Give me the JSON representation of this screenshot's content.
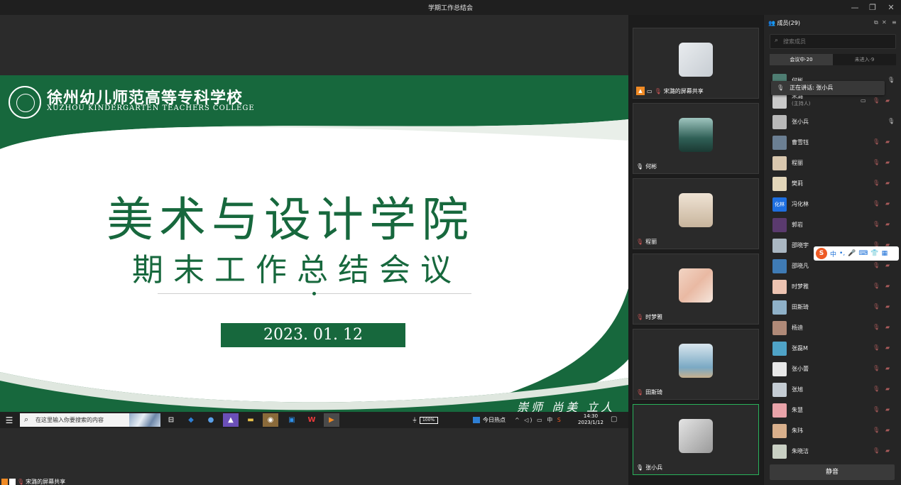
{
  "window": {
    "title": "学期工作总结会",
    "minimize": "—",
    "restore": "❐",
    "close": "✕"
  },
  "slide": {
    "school_cn": "徐州幼儿师范高等专科学校",
    "school_en": "XUZHOU KINDERGARTEN TEACHERS COLLEGE",
    "title": "美术与设计学院",
    "subtitle": "期末工作总结会议",
    "date": "2023. 01. 12",
    "motto": "崇师 尚美 立人",
    "accent_color": "#17683d"
  },
  "taskbar": {
    "search_placeholder": "在这里输入你要搜索的内容",
    "battery": "100%",
    "news": "今日热点",
    "ime_indicator": "中",
    "time": "14:30",
    "date": "2023/1/12"
  },
  "share_label": "宋潞的屏幕共享",
  "video_tiles": [
    {
      "name": "宋潞的屏幕共享",
      "icon": "screen-share-icon",
      "av": "linear-gradient(135deg,#e9ecef,#c7cdd3)"
    },
    {
      "name": "何彬",
      "icon": "mic-icon",
      "av": "linear-gradient(180deg,#9fc5bf,#2f5f56 60%,#1b3a33)"
    },
    {
      "name": "程丽",
      "icon": "mic-muted-icon",
      "av": "linear-gradient(180deg,#efe3d4,#c8b59d)"
    },
    {
      "name": "时梦雅",
      "icon": "mic-muted-icon",
      "av": "linear-gradient(135deg,#f2d5c4,#e9b9a3 50%,#f5e6dc)"
    },
    {
      "name": "田斯琦",
      "icon": "mic-muted-icon",
      "av": "linear-gradient(180deg,#d9e6ee,#7aa9c4 70%,#c7b08e)"
    },
    {
      "name": "张小兵",
      "icon": "mic-icon",
      "av": "linear-gradient(135deg,#e4e4e4,#9a9a9a)"
    }
  ],
  "panel": {
    "title": "成员(29)",
    "search_placeholder": "搜索成员",
    "tab_in": "会议中·20",
    "tab_out": "未进入·9",
    "speaking": "正在讲话: 张小兵",
    "mute_all": "静音",
    "members": [
      {
        "name": "何彬",
        "role": "",
        "av": "#4e7d72",
        "mic": "on",
        "cam": false,
        "scr": false
      },
      {
        "name": "宋潞",
        "role": "(主持人)",
        "av": "#c9c9c9",
        "mic": "off",
        "cam": true,
        "scr": true
      },
      {
        "name": "张小兵",
        "role": "",
        "av": "#b9b9b9",
        "mic": "on",
        "cam": false,
        "scr": false
      },
      {
        "name": "曹雪钰",
        "role": "",
        "av": "#6b7f93",
        "mic": "off",
        "cam": true,
        "scr": false
      },
      {
        "name": "程丽",
        "role": "",
        "av": "#d9c7ae",
        "mic": "off",
        "cam": true,
        "scr": false
      },
      {
        "name": "樊莉",
        "role": "",
        "av": "#e3d6b9",
        "mic": "off",
        "cam": true,
        "scr": false
      },
      {
        "name": "冯化林",
        "role": "",
        "av": "#1e6fe0",
        "badge": "化林",
        "mic": "off",
        "cam": true,
        "scr": false
      },
      {
        "name": "郭岩",
        "role": "",
        "av": "#5a3a6e",
        "mic": "off",
        "cam": true,
        "scr": false
      },
      {
        "name": "邵晓宇",
        "role": "",
        "av": "#aab7c2",
        "mic": "off",
        "cam": true,
        "scr": false
      },
      {
        "name": "邵晓凡",
        "role": "",
        "av": "#3f7bb5",
        "mic": "off",
        "cam": true,
        "scr": false
      },
      {
        "name": "时梦雅",
        "role": "",
        "av": "#ecc3b1",
        "mic": "off",
        "cam": true,
        "scr": false
      },
      {
        "name": "田斯琦",
        "role": "",
        "av": "#8fb1c8",
        "mic": "off",
        "cam": true,
        "scr": false
      },
      {
        "name": "杨迪",
        "role": "",
        "av": "#b08a78",
        "mic": "off",
        "cam": true,
        "scr": false
      },
      {
        "name": "张磊M",
        "role": "",
        "av": "#4fa3c7",
        "mic": "off",
        "cam": true,
        "scr": false
      },
      {
        "name": "张小蕾",
        "role": "",
        "av": "#e8e8e8",
        "mic": "off",
        "cam": true,
        "scr": false
      },
      {
        "name": "张旭",
        "role": "",
        "av": "#c4ccd3",
        "mic": "off",
        "cam": true,
        "scr": false
      },
      {
        "name": "朱慧",
        "role": "",
        "av": "#e9a3a9",
        "mic": "off",
        "cam": true,
        "scr": false
      },
      {
        "name": "朱玮",
        "role": "",
        "av": "#d9b08c",
        "mic": "off",
        "cam": true,
        "scr": false
      },
      {
        "name": "朱晓洁",
        "role": "",
        "av": "#c9d0c4",
        "mic": "off",
        "cam": true,
        "scr": false
      }
    ]
  },
  "ime_toolbar": {
    "logo": "S",
    "lang": "中",
    "punct": "•,",
    "mic": "🎤",
    "keyboard": "⌨",
    "skin": "👕",
    "grid": "▦"
  }
}
